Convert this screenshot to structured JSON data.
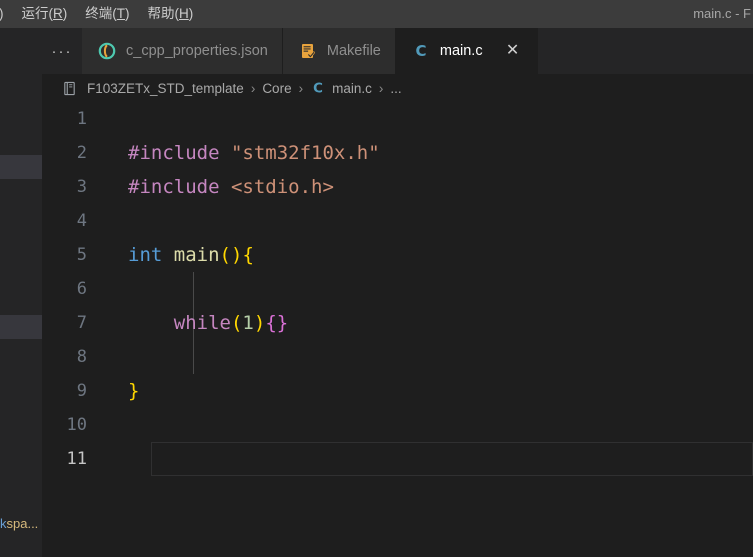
{
  "window": {
    "title": "main.c - F",
    "menu": [
      {
        "label": "运行(R)",
        "mnemonic": "R",
        "base": "运行("
      },
      {
        "label": "终端(T)",
        "mnemonic": "T",
        "base": "终端("
      },
      {
        "label": "帮助(H)",
        "mnemonic": "H",
        "base": "帮助("
      }
    ],
    "menu_cut_left": ")"
  },
  "sidebar": {
    "truncated_label_prefix": "k",
    "truncated_label": "kspa...",
    "rows": 2
  },
  "tabbar": {
    "overflow_label": "···",
    "tabs": [
      {
        "label": "c_cpp_properties.json",
        "icon": "json-icon",
        "active": false,
        "closable": false
      },
      {
        "label": "Makefile",
        "icon": "makefile-icon",
        "active": false,
        "closable": false
      },
      {
        "label": "main.c",
        "icon": "c-file-icon",
        "active": true,
        "closable": true,
        "close_label": "✕"
      }
    ]
  },
  "breadcrumb": {
    "icon": "book-outline-icon",
    "segments": [
      "F103ZETx_STD_template",
      "Core",
      "main.c",
      "..."
    ],
    "separator": "›",
    "file_icon_before_index": 2
  },
  "editor": {
    "language": "c",
    "active_line": 11,
    "lines": [
      {
        "no": "1",
        "tokens": []
      },
      {
        "no": "2",
        "tokens": [
          {
            "t": "pre",
            "v": "#include"
          },
          {
            "t": "plain",
            "v": " "
          },
          {
            "t": "str",
            "v": "\"stm32f10x.h\""
          }
        ]
      },
      {
        "no": "3",
        "tokens": [
          {
            "t": "pre",
            "v": "#include"
          },
          {
            "t": "plain",
            "v": " "
          },
          {
            "t": "str",
            "v": "<stdio.h>"
          }
        ]
      },
      {
        "no": "4",
        "tokens": []
      },
      {
        "no": "5",
        "tokens": [
          {
            "t": "kw",
            "v": "int"
          },
          {
            "t": "plain",
            "v": " "
          },
          {
            "t": "fn",
            "v": "main"
          },
          {
            "t": "p1",
            "v": "("
          },
          {
            "t": "p1",
            "v": ")"
          },
          {
            "t": "brace",
            "v": "{"
          }
        ]
      },
      {
        "no": "6",
        "tokens": []
      },
      {
        "no": "7",
        "tokens": [
          {
            "t": "plain",
            "v": "    "
          },
          {
            "t": "pre",
            "v": "while"
          },
          {
            "t": "p1",
            "v": "("
          },
          {
            "t": "num",
            "v": "1"
          },
          {
            "t": "p1",
            "v": ")"
          },
          {
            "t": "p2",
            "v": "{"
          },
          {
            "t": "p2",
            "v": "}"
          }
        ]
      },
      {
        "no": "8",
        "tokens": []
      },
      {
        "no": "9",
        "tokens": [
          {
            "t": "brace",
            "v": "}"
          }
        ]
      },
      {
        "no": "10",
        "tokens": []
      },
      {
        "no": "11",
        "tokens": []
      }
    ]
  },
  "colors": {
    "editor_background": "#1e1e1e",
    "titlebar_background": "#3c3c3c",
    "tabbar_background": "#252526",
    "inactive_tab_background": "#2d2d2d",
    "sidebar_background": "#252526",
    "sidebar_row_highlight": "#37373d",
    "line_number": "#6e7681",
    "active_line_number": "#c6c6c6",
    "preprocessor": "#c586c0",
    "string": "#ce9178",
    "keyword": "#569cd6",
    "function": "#dcdcaa",
    "number": "#b5cea8",
    "bracket_yellow": "#ffd700",
    "bracket_magenta": "#da70d6",
    "indent_guide": "#4a4a4a"
  }
}
